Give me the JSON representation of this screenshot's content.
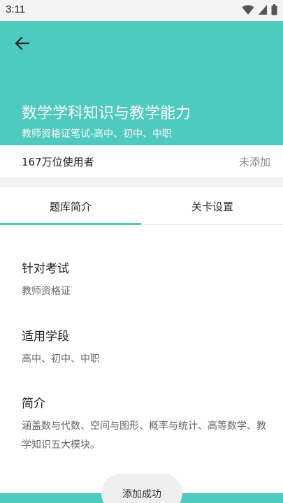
{
  "status_bar": {
    "time": "3:11"
  },
  "header": {
    "title": "数学学科知识与教学能力",
    "subtitle": "教师资格证笔试-高中、初中、中职"
  },
  "info": {
    "users": "167万位使用者",
    "add_status": "未添加"
  },
  "tabs": [
    {
      "label": "题库简介",
      "active": true
    },
    {
      "label": "关卡设置",
      "active": false
    }
  ],
  "sections": [
    {
      "heading": "针对考试",
      "text": "教师资格证"
    },
    {
      "heading": "适用学段",
      "text": "高中、初中、中职"
    },
    {
      "heading": "简介",
      "text": "涵盖数与代数、空间与图形、概率与统计、高等数学、教学知识五大模块。"
    }
  ],
  "toast": {
    "text": "添加成功"
  },
  "colors": {
    "accent": "#4fcabf"
  }
}
